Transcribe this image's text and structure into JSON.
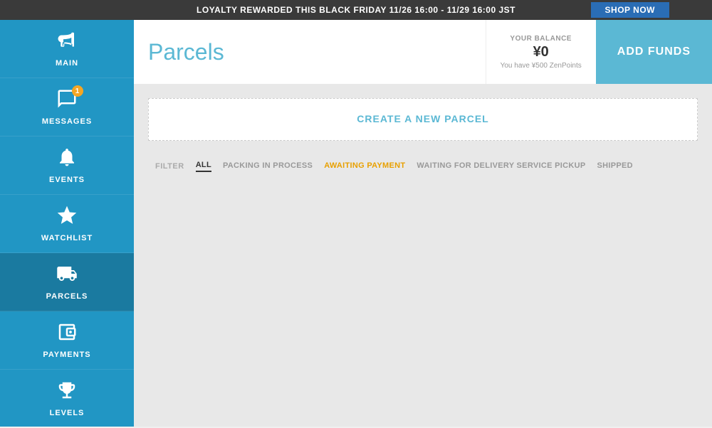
{
  "banner": {
    "text": "LOYALTY REWARDED THIS BLACK FRIDAY 11/26 16:00 - 11/29 16:00 JST",
    "shop_now": "SHOP NOW"
  },
  "sidebar": {
    "items": [
      {
        "id": "main",
        "label": "MAIN",
        "icon": "megaphone"
      },
      {
        "id": "messages",
        "label": "MESSAGES",
        "icon": "chat",
        "badge": "1"
      },
      {
        "id": "events",
        "label": "EVENTS",
        "icon": "bell"
      },
      {
        "id": "watchlist",
        "label": "WATCHLIST",
        "icon": "star"
      },
      {
        "id": "parcels",
        "label": "PARCELS",
        "icon": "truck",
        "active": true
      },
      {
        "id": "payments",
        "label": "PAYMENTS",
        "icon": "wallet"
      },
      {
        "id": "levels",
        "label": "LEVELS",
        "icon": "trophy"
      }
    ]
  },
  "header": {
    "page_title": "Parcels",
    "balance": {
      "label": "YOUR BALANCE",
      "amount": "¥0",
      "points_text": "You have ¥500 ZenPoints"
    },
    "add_funds_label": "ADD FUNDS"
  },
  "content": {
    "create_parcel_label": "CREATE A NEW PARCEL",
    "filter_label": "FILTER",
    "filters": [
      {
        "id": "all",
        "label": "ALL",
        "active": true,
        "style": "active"
      },
      {
        "id": "packing",
        "label": "PACKING IN PROCESS",
        "style": "packing"
      },
      {
        "id": "awaiting",
        "label": "AWAITING PAYMENT",
        "style": "awaiting"
      },
      {
        "id": "waiting",
        "label": "WAITING FOR DELIVERY SERVICE PICKUP",
        "style": "waiting"
      },
      {
        "id": "shipped",
        "label": "SHIPPED",
        "style": "shipped"
      }
    ]
  }
}
